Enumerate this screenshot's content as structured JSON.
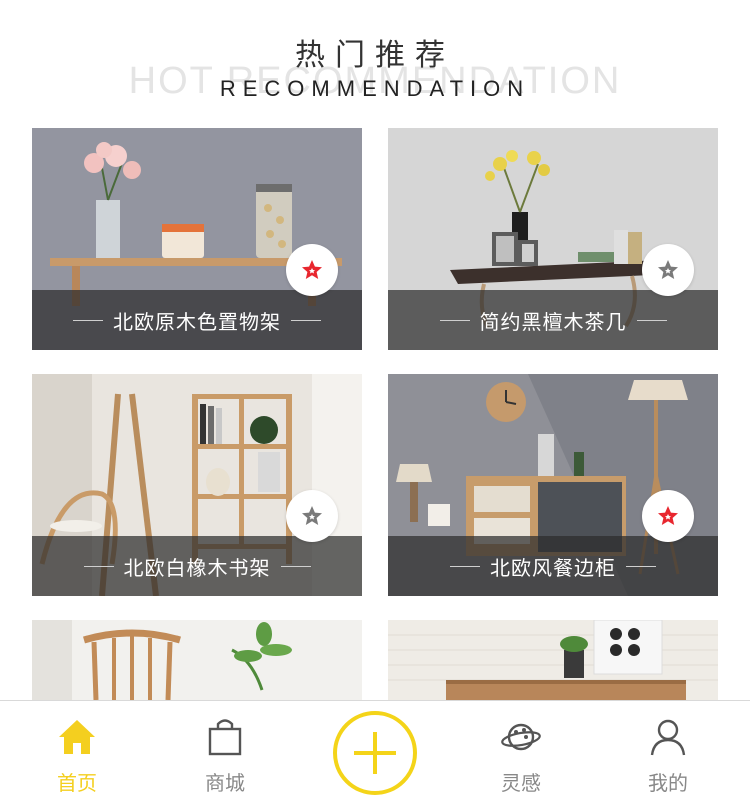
{
  "section": {
    "title_cn": "热门推荐",
    "title_en": "RECOMMENDATION",
    "watermark_en": "HOT RECOMMENDATION"
  },
  "products": [
    {
      "name": "北欧原木色置物架",
      "favorited": true
    },
    {
      "name": "简约黑檀木茶几",
      "favorited": false
    },
    {
      "name": "北欧白橡木书架",
      "favorited": false
    },
    {
      "name": "北欧风餐边柜",
      "favorited": true
    }
  ],
  "tabbar": {
    "items": [
      {
        "label": "首页",
        "icon": "home-icon",
        "active": true
      },
      {
        "label": "商城",
        "icon": "shopping-bag-icon",
        "active": false
      },
      {
        "label": "",
        "icon": "plus-icon",
        "active": false
      },
      {
        "label": "灵感",
        "icon": "planet-icon",
        "active": false
      },
      {
        "label": "我的",
        "icon": "user-icon",
        "active": false
      }
    ]
  },
  "colors": {
    "accent": "#f4d419",
    "favorite_active": "#e8262e",
    "favorite_inactive": "#7a7a7a",
    "tab_inactive": "#888888"
  }
}
